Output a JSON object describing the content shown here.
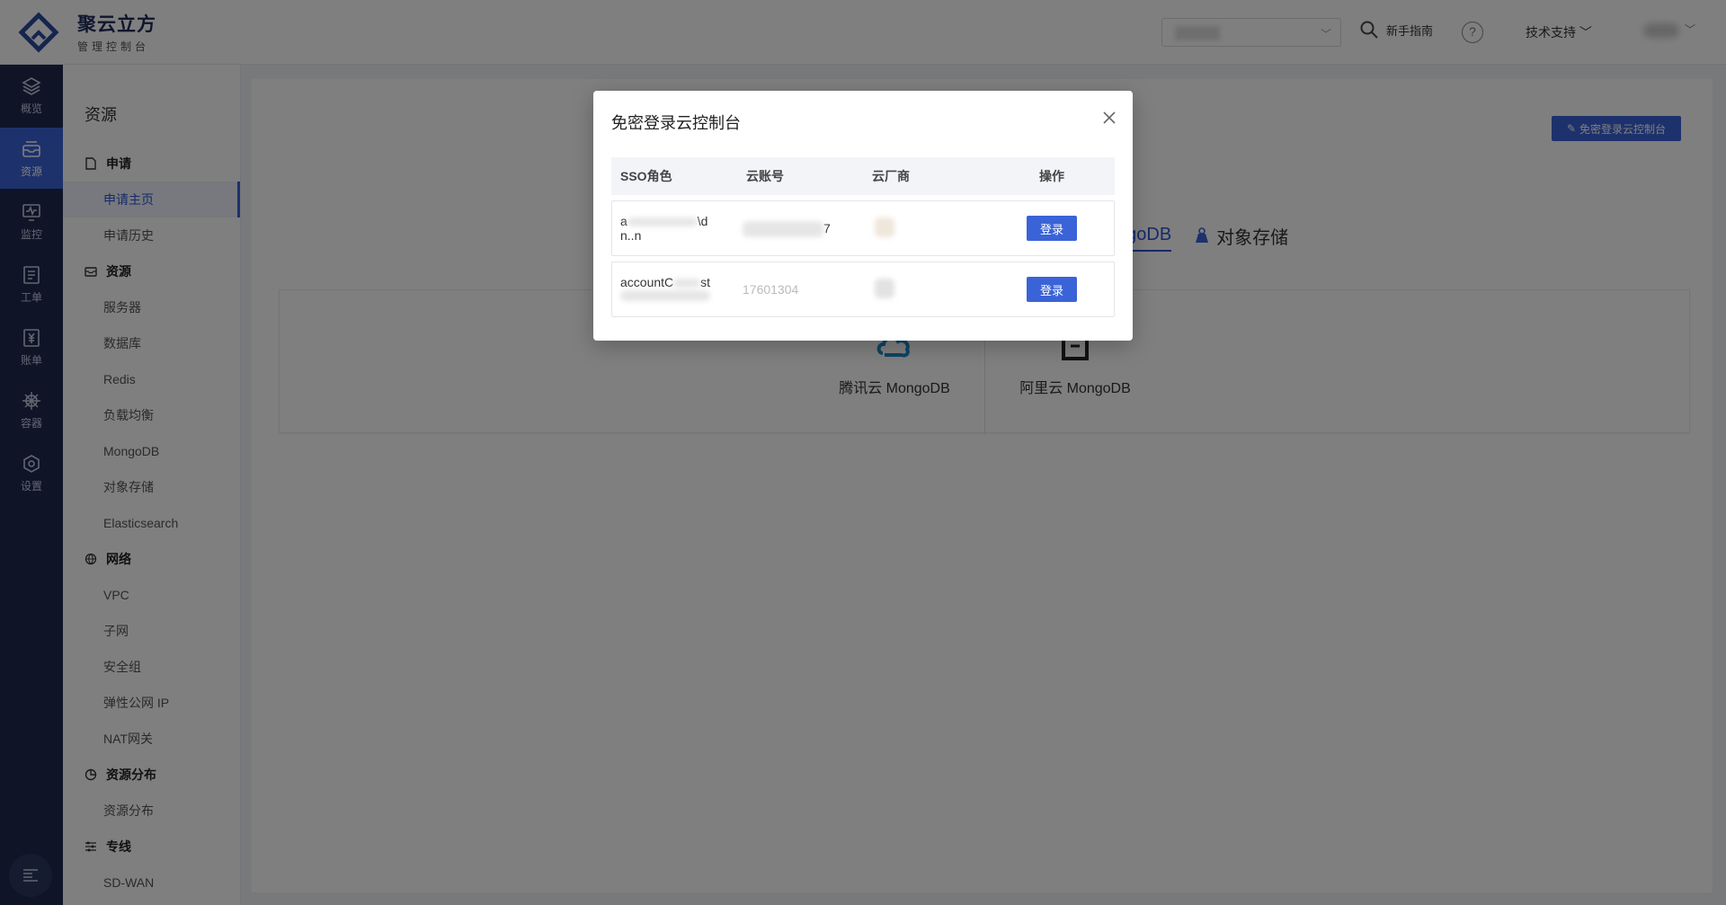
{
  "header": {
    "brand_name": "聚云立方",
    "brand_sub": "管理控制台",
    "guide": "新手指南",
    "help": "?",
    "support": "技术支持 ﹀"
  },
  "rail": [
    {
      "label": "概览",
      "icon": "layers-icon"
    },
    {
      "label": "资源",
      "icon": "inbox-icon",
      "active": true
    },
    {
      "label": "监控",
      "icon": "monitor-icon"
    },
    {
      "label": "工单",
      "icon": "ticket-icon"
    },
    {
      "label": "账单",
      "icon": "bill-icon"
    },
    {
      "label": "容器",
      "icon": "helm-icon"
    },
    {
      "label": "设置",
      "icon": "settings-icon"
    }
  ],
  "sidenav": {
    "title": "资源",
    "groups": {
      "apply": {
        "label": "申请",
        "items": [
          "申请主页",
          "申请历史"
        ]
      },
      "resource": {
        "label": "资源",
        "items": [
          "服务器",
          "数据库",
          "Redis",
          "负载均衡",
          "MongoDB",
          "对象存储",
          "Elasticsearch"
        ]
      },
      "network": {
        "label": "网络",
        "items": [
          "VPC",
          "子网",
          "安全组",
          "弹性公网 IP",
          "NAT网关"
        ]
      },
      "dist": {
        "label": "资源分布",
        "items": [
          "资源分布"
        ]
      },
      "line": {
        "label": "专线",
        "items": [
          "SD-WAN"
        ]
      }
    }
  },
  "main": {
    "sso_button": "免密登录云控制台",
    "tabs": [
      "ngoDB",
      "对象存储"
    ],
    "providers": [
      "腾讯云 MongoDB",
      "阿里云 MongoDB"
    ]
  },
  "modal": {
    "title": "免密登录云控制台",
    "columns": [
      "SSO角色",
      "云账号",
      "云厂商",
      "操作"
    ],
    "rows": [
      {
        "role_a": "a",
        "role_b": "\\d",
        "role_c": "n..n",
        "account": "7",
        "action": "登录"
      },
      {
        "role_a": "accountC",
        "role_b": "st",
        "role_c": "",
        "account": "17601304",
        "action": "登录"
      }
    ]
  },
  "colors": {
    "primary": "#3a63d8",
    "rail_bg": "#1e2a4f"
  }
}
